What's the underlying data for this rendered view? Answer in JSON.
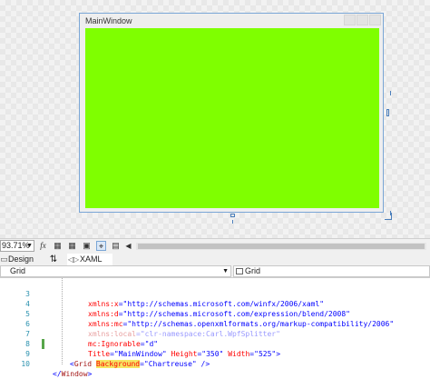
{
  "design": {
    "window_title": "MainWindow",
    "grid_background": "#7fff00",
    "frame_border": "#7aa6d6"
  },
  "toolbar": {
    "zoom": "93.71%",
    "fx_label": "fx",
    "icons": [
      "fx-icon",
      "grid-layout-icon",
      "grid-icon",
      "snap-gridlines-icon",
      "snap-lines-icon",
      "annotation-icon",
      "scroll-left-icon"
    ]
  },
  "tabs": {
    "design_label": "Design",
    "swap_label": "⇅",
    "xaml_label": "XAML"
  },
  "selectors": {
    "left": "Grid",
    "right": "Grid"
  },
  "code": {
    "lines": [
      {
        "num": "3",
        "attr": "xmlns:x",
        "eq": "=",
        "val": "\"http://schemas.microsoft.com/winfx/2006/xaml\""
      },
      {
        "num": "4",
        "attr": "xmlns:d",
        "eq": "=",
        "val": "\"http://schemas.microsoft.com/expression/blend/2008\""
      },
      {
        "num": "5",
        "attr": "xmlns:mc",
        "eq": "=",
        "val": "\"http://schemas.openxmlformats.org/markup-compatibility/2006\""
      },
      {
        "num": "6",
        "attr": "xmlns:local",
        "eq": "=",
        "val": "\"clr-namespace:Carl.WpfSplitter\""
      },
      {
        "num": "7",
        "attr": "mc:Ignorable",
        "eq": "=",
        "val": "\"d\""
      },
      {
        "num": "8",
        "attr": "Title",
        "eq": "=",
        "val": "\"MainWindow\"",
        "attr2": "Height",
        "val2": "\"350\"",
        "attr3": "Width",
        "val3": "\"525\"",
        "close": ">"
      },
      {
        "num": "9",
        "open": "<",
        "tag": "Grid",
        "attr": "Background",
        "eq": "=",
        "val": "\"Chartreuse\"",
        "close": " />"
      },
      {
        "num": "10",
        "open": "</",
        "tag": "Window",
        "close": ">"
      }
    ]
  }
}
